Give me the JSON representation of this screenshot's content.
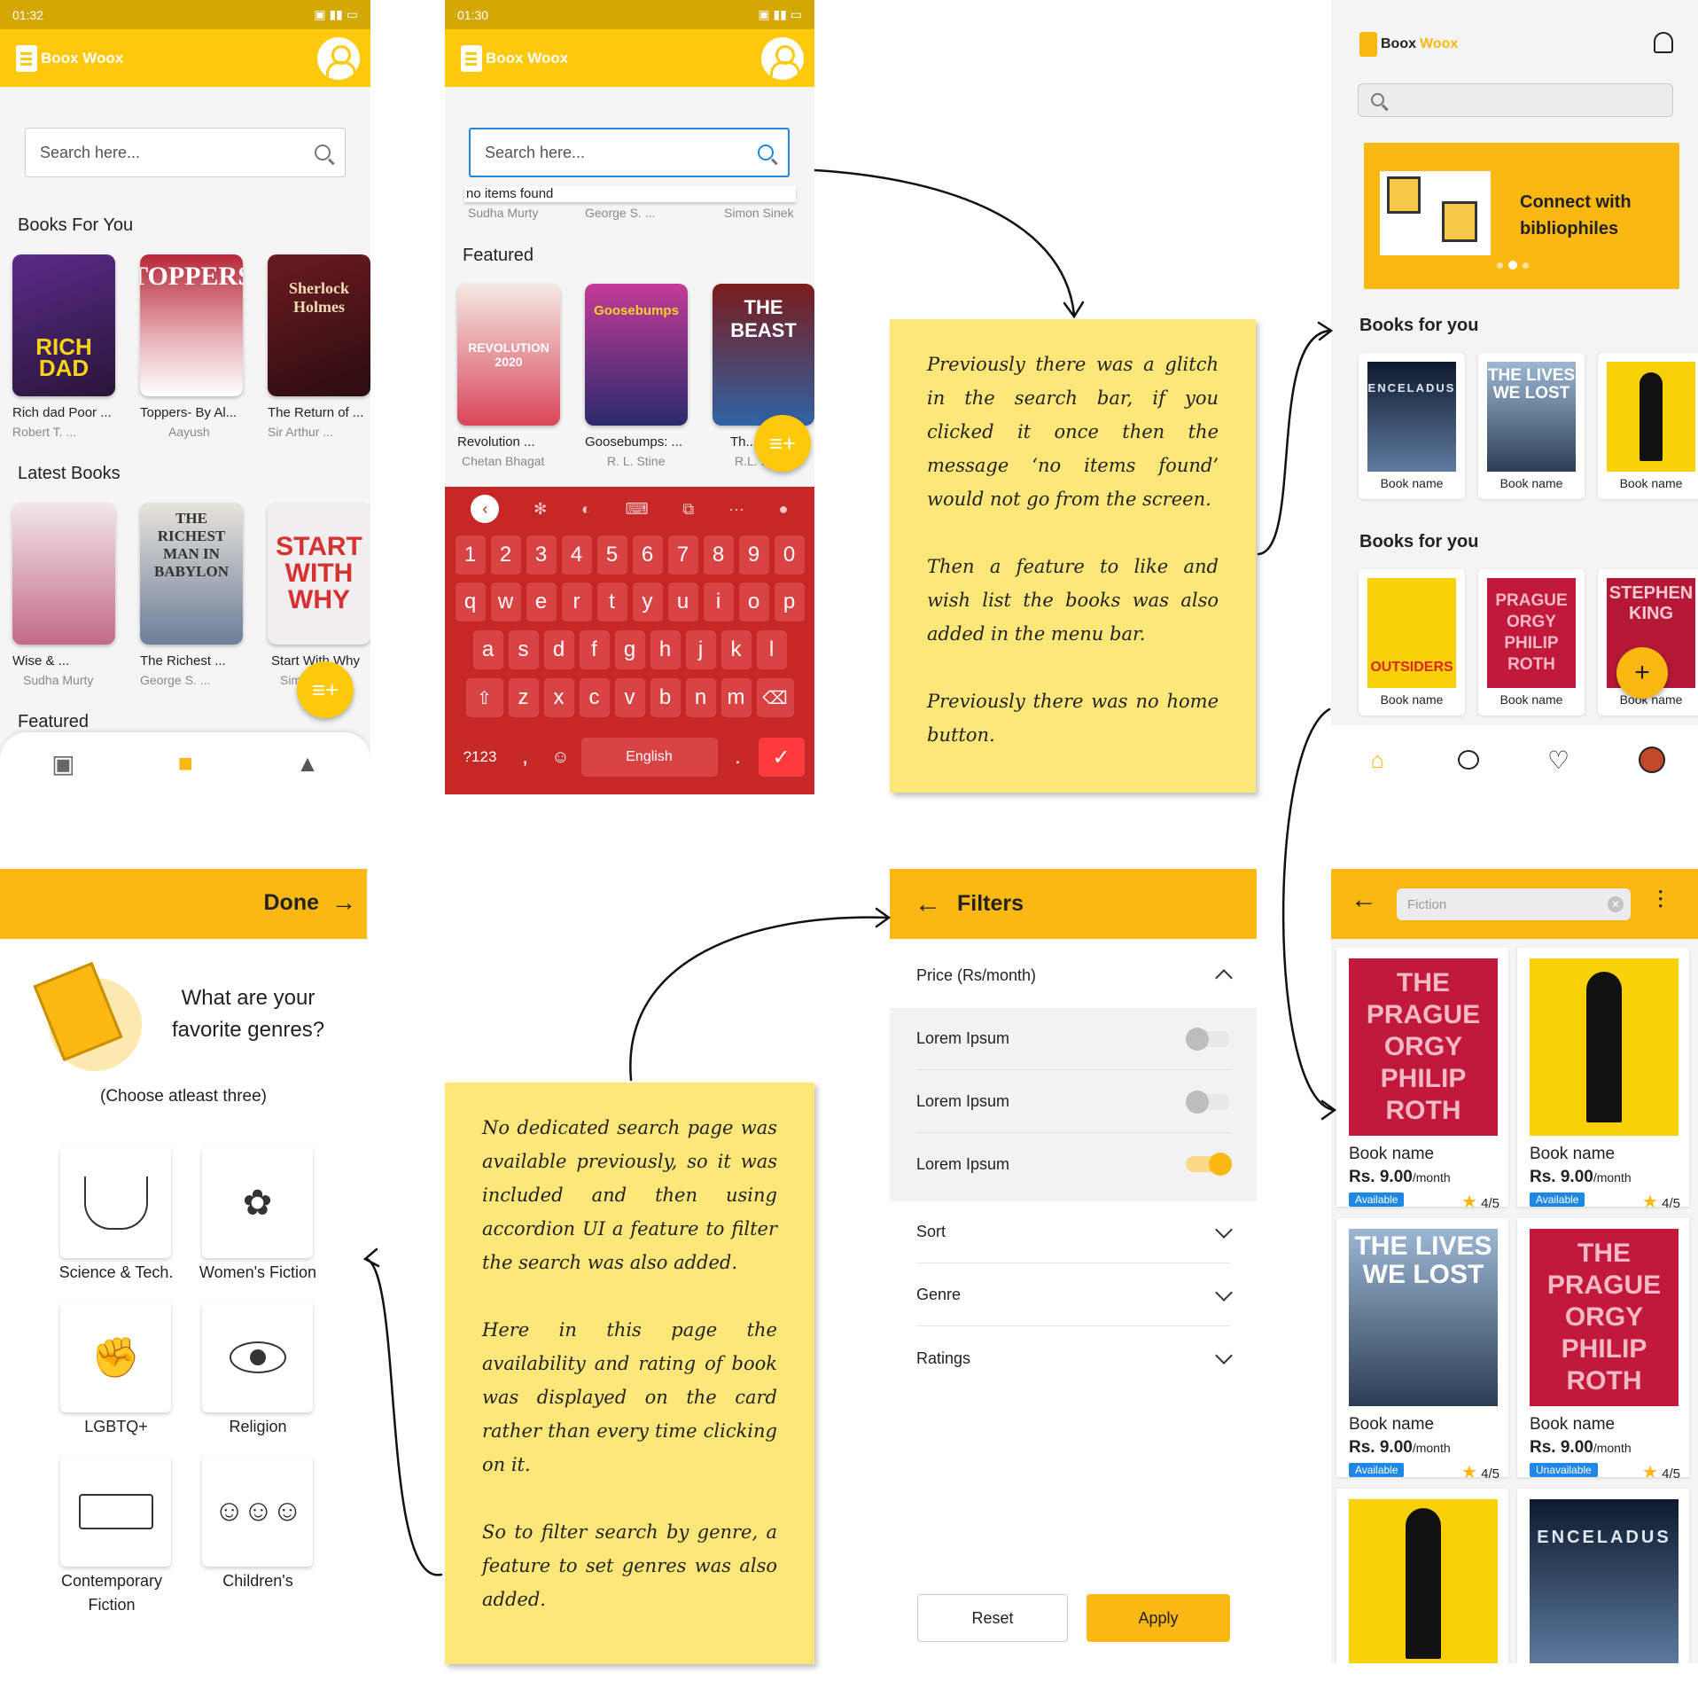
{
  "brand": {
    "name_a": "Boox",
    "name_b": "Woox",
    "name_full": "Boox Woox",
    "accent": "#fdc90a",
    "accent_dark": "#fbb712"
  },
  "screen_old_home": {
    "status_time": "01:32",
    "search_placeholder": "Search here...",
    "section_for_you": "Books For You",
    "books_for_you": [
      {
        "title": "Rich dad Poor ...",
        "author": "Robert T. ...",
        "cover_text": "RICH DAD POOR DAD"
      },
      {
        "title": "Toppers- By Al...",
        "author": "Aayush",
        "cover_text": "TOPPERS"
      },
      {
        "title": "The Return of ...",
        "author": "Sir Arthur ...",
        "cover_text": "Sherlock Holmes"
      }
    ],
    "section_latest": "Latest Books",
    "latest_books": [
      {
        "title": "Wise & ...",
        "author": "Sudha Murty",
        "cover_text": ""
      },
      {
        "title": "The Richest ...",
        "author": "George S. ...",
        "cover_text": "THE RICHEST MAN IN BABYLON"
      },
      {
        "title": "Start With Why",
        "author": "Simon Sinek",
        "cover_text": "START WITH WHY"
      }
    ],
    "section_featured": "Featured"
  },
  "screen_old_search": {
    "status_time": "01:30",
    "search_placeholder": "Search here...",
    "dropdown_text": "no items found",
    "behind_authors": [
      "Sudha Murty",
      "George S. ...",
      "Simon Sinek"
    ],
    "section_featured": "Featured",
    "featured": [
      {
        "title": "Revolution ...",
        "author": "Chetan Bhagat",
        "cover_text": "REVOLUTION 2020"
      },
      {
        "title": "Goosebumps: ...",
        "author": "R. L. Stine",
        "cover_text": "Goosebumps"
      },
      {
        "title": "Th...",
        "author": "R.L. ...",
        "cover_text": "THE BEAST"
      }
    ],
    "keyboard": {
      "numbers": [
        "1",
        "2",
        "3",
        "4",
        "5",
        "6",
        "7",
        "8",
        "9",
        "0"
      ],
      "row1": [
        "q",
        "w",
        "e",
        "r",
        "t",
        "y",
        "u",
        "i",
        "o",
        "p"
      ],
      "row2": [
        "a",
        "s",
        "d",
        "f",
        "g",
        "h",
        "j",
        "k",
        "l"
      ],
      "row3": [
        "z",
        "x",
        "c",
        "v",
        "b",
        "n",
        "m"
      ],
      "sym_key": "?123",
      "space_label": "English"
    }
  },
  "note_1": {
    "paragraphs": [
      "Previously there was a glitch in the search bar, if you clicked it once then the message ‘no items found’ would not go from the screen.",
      "Then a feature to like and wish list the books was also added in the menu bar.",
      "Previously there was no home button."
    ]
  },
  "note_2": {
    "paragraphs": [
      "No dedicated search page was available previously, so it was included and then using accordion UI a feature to filter the search was also added.",
      "Here in this page the availability and rating of book was displayed on the card rather than every time clicking on it.",
      "So to filter search by genre, a feature to set genres was also added."
    ]
  },
  "screen_new_home": {
    "banner_text": "Connect with bibliophiles",
    "section_1": "Books for you",
    "section_2": "Books for you",
    "row_1": [
      {
        "name": "Book name",
        "cover_text": "ENCELADUS"
      },
      {
        "name": "Book name",
        "cover_text": "THE LIVES WE LOST"
      },
      {
        "name": "Book name",
        "cover_text": ""
      }
    ],
    "row_2": [
      {
        "name": "Book name",
        "cover_text": "OUTSIDERS"
      },
      {
        "name": "Book name",
        "cover_text": "PRAGUE ORGY PHILIP ROTH"
      },
      {
        "name": "Book name",
        "cover_text": "STEPHEN KING"
      }
    ]
  },
  "screen_genres": {
    "done_label": "Done",
    "question": "What are your favorite genres?",
    "hint": "(Choose atleast three)",
    "genres": [
      "Science & Tech.",
      "Women's Fiction",
      "LGBTQ+",
      "Religion",
      "Contemporary Fiction",
      "Children's"
    ]
  },
  "screen_filters": {
    "title": "Filters",
    "price_header": "Price (Rs/month)",
    "options": [
      {
        "label": "Lorem Ipsum",
        "on": false
      },
      {
        "label": "Lorem Ipsum",
        "on": false
      },
      {
        "label": "Lorem Ipsum",
        "on": true
      }
    ],
    "sections": [
      "Sort",
      "Genre",
      "Ratings"
    ],
    "reset_label": "Reset",
    "apply_label": "Apply"
  },
  "screen_results": {
    "search_value": "Fiction",
    "results": [
      {
        "name": "Book name",
        "price": "Rs. 9.00",
        "per": "/month",
        "status": "Available",
        "rating": "4/5",
        "cover_text": "THE PRAGUE ORGY PHILIP ROTH"
      },
      {
        "name": "Book name",
        "price": "Rs. 9.00",
        "per": "/month",
        "status": "Available",
        "rating": "4/5",
        "cover_text": ""
      },
      {
        "name": "Book name",
        "price": "Rs. 9.00",
        "per": "/month",
        "status": "Available",
        "rating": "4/5",
        "cover_text": "THE LIVES WE LOST"
      },
      {
        "name": "Book name",
        "price": "Rs. 9.00",
        "per": "/month",
        "status": "Unavailable",
        "rating": "4/5",
        "cover_text": "THE PRAGUE ORGY PHILIP ROTH"
      }
    ],
    "partial_covers": [
      "",
      "ENCELADUS"
    ]
  }
}
